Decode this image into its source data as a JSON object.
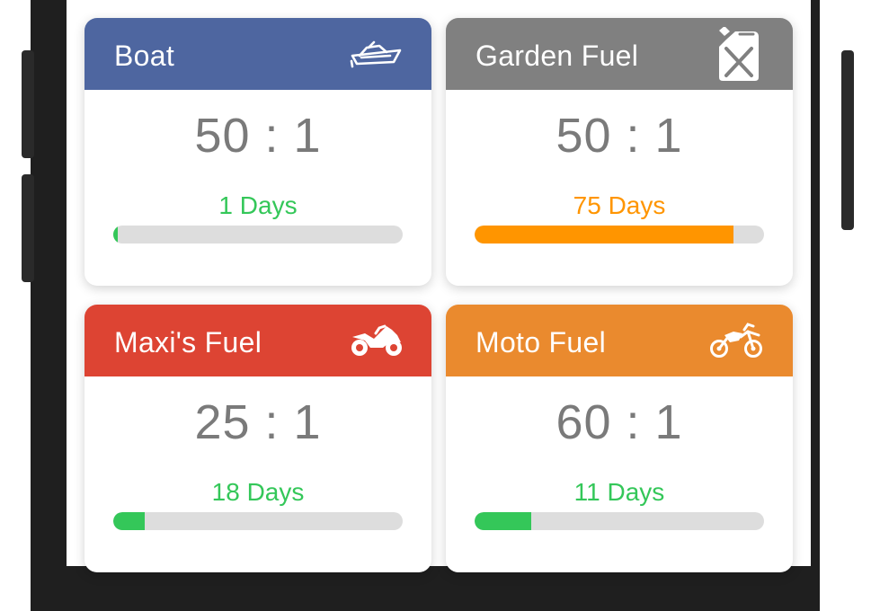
{
  "cards": [
    {
      "title": "Boat",
      "icon": "boat-icon",
      "header_color": "#4e66a0",
      "ratio": "50 : 1",
      "days_label": "1 Days",
      "days_color": "#34c759",
      "progress_percent": 1.5,
      "bar_color": "#34c759"
    },
    {
      "title": "Garden Fuel",
      "icon": "fuel-can-icon",
      "header_color": "#808080",
      "ratio": "50 : 1",
      "days_label": "75 Days",
      "days_color": "#ff9500",
      "progress_percent": 89.5,
      "bar_color": "#ff9500"
    },
    {
      "title": "Maxi's Fuel",
      "icon": "sport-motorcycle-icon",
      "header_color": "#dd4433",
      "ratio": "25 : 1",
      "days_label": "18 Days",
      "days_color": "#34c759",
      "progress_percent": 11,
      "bar_color": "#34c759"
    },
    {
      "title": "Moto Fuel",
      "icon": "dirt-bike-icon",
      "header_color": "#ea8a2e",
      "ratio": "60 : 1",
      "days_label": "11 Days",
      "days_color": "#34c759",
      "progress_percent": 19.5,
      "bar_color": "#34c759"
    }
  ]
}
